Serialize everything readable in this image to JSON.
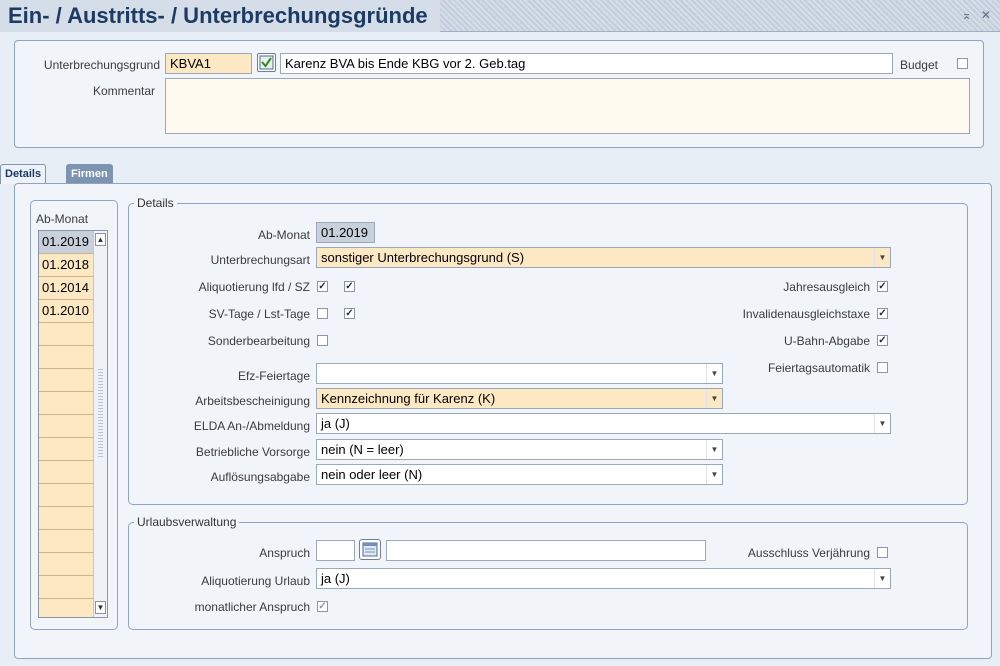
{
  "window": {
    "title": "Ein- / Austritts- / Unterbrechungsgründe",
    "controls": "⌅ ✕"
  },
  "header": {
    "reason_label": "Unterbrechungsgrund",
    "reason_code": "KBVA1",
    "reason_text": "Karenz BVA bis Ende KBG vor 2. Geb.tag",
    "budget_label": "Budget",
    "budget_checked": false,
    "comment_label": "Kommentar",
    "comment_value": ""
  },
  "tabs": [
    {
      "label": "Details",
      "active": true
    },
    {
      "label": "Firmen",
      "active": false
    }
  ],
  "month_list": {
    "header": "Ab-Monat",
    "items": [
      "01.2019",
      "01.2018",
      "01.2014",
      "01.2010"
    ],
    "selected": 0
  },
  "details": {
    "legend": "Details",
    "ab_monat_label": "Ab-Monat",
    "ab_monat_value": "01.2019",
    "art_label": "Unterbrechungsart",
    "art_value": "sonstiger Unterbrechungsgrund (S)",
    "aliq_label": "Aliquotierung lfd / SZ",
    "aliq_lfd": true,
    "aliq_sz": true,
    "sv_label": "SV-Tage / Lst-Tage",
    "sv_tage": false,
    "lst_tage": true,
    "sonder_label": "Sonderbearbeitung",
    "sonder": false,
    "jahres_label": "Jahresausgleich",
    "jahres": true,
    "invalid_label": "Invalidenausgleichstaxe",
    "invalid": true,
    "ubahn_label": "U-Bahn-Abgabe",
    "ubahn": true,
    "feiertags_label": "Feiertagsautomatik",
    "feiertags": false,
    "efz_label": "Efz-Feiertage",
    "efz_value": "",
    "arbeit_label": "Arbeitsbescheinigung",
    "arbeit_value": "Kennzeichnung für Karenz (K)",
    "elda_label": "ELDA An-/Abmeldung",
    "elda_value": "ja (J)",
    "betrieb_label": "Betriebliche Vorsorge",
    "betrieb_value": "nein (N = leer)",
    "aufl_label": "Auflösungsabgabe",
    "aufl_value": "nein oder leer (N)"
  },
  "urlaub": {
    "legend": "Urlaubsverwaltung",
    "anspruch_label": "Anspruch",
    "anspruch_value": "",
    "anspruch_text": "",
    "verj_label": "Ausschluss Verjährung",
    "verj": false,
    "aliq_label": "Aliquotierung Urlaub",
    "aliq_value": "ja (J)",
    "monat_label": "monatlicher Anspruch",
    "monat": true
  }
}
